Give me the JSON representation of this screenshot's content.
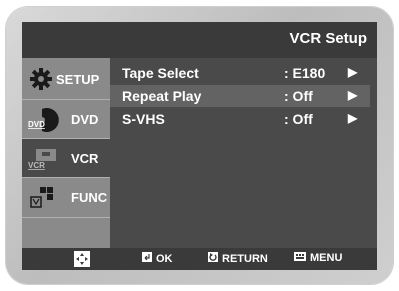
{
  "window": {
    "title": "VCR Setup"
  },
  "sidebar": {
    "items": [
      {
        "label": "SETUP",
        "icon": "gear-icon"
      },
      {
        "label": "DVD",
        "icon": "dvd-disc-icon",
        "icon_text": "DVD"
      },
      {
        "label": "VCR",
        "icon": "vcr-tape-icon",
        "icon_text": "VCR"
      },
      {
        "label": "FUNC",
        "icon": "function-icon"
      }
    ],
    "active": "VCR"
  },
  "menu": {
    "rows": [
      {
        "label": "Tape Select",
        "value": ": E180",
        "arrow": "▶"
      },
      {
        "label": "Repeat Play",
        "value": ": Off",
        "arrow": "▶",
        "highlighted": true
      },
      {
        "label": "S-VHS",
        "value": ": Off",
        "arrow": "▶"
      }
    ]
  },
  "bottom_bar": {
    "nav_icon": "directional-pad-icon",
    "ok_label": "OK",
    "return_label": "RETURN",
    "menu_label": "MENU"
  },
  "colors": {
    "screen_bg": "#4a4a4a",
    "title_bar": "#3a3a3a",
    "sidebar_bg": "#8a8a8a",
    "highlight_row": "#636363",
    "text": "#ffffff"
  }
}
